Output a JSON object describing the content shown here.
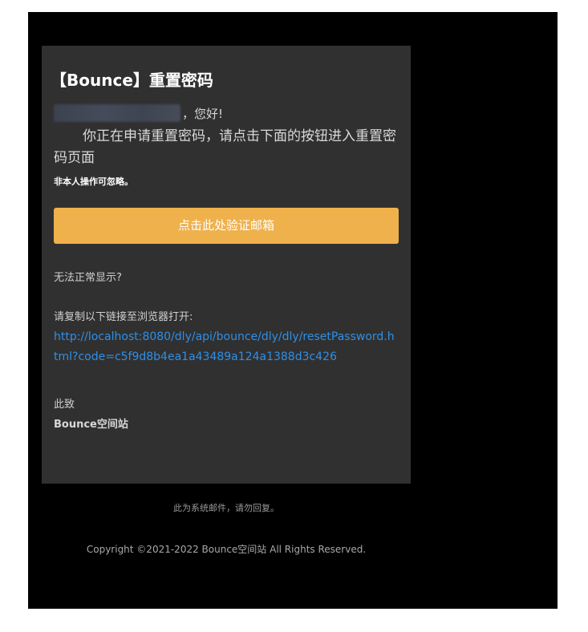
{
  "email": {
    "title": "【Bounce】重置密码",
    "greeting_suffix": "，您好!",
    "main_text": "你正在申请重置密码，请点击下面的按钮进入重置密码页面",
    "ignore_note": "非本人操作可忽略。",
    "button_label": "点击此处验证邮箱",
    "cant_display": "无法正常显示?",
    "copy_prompt": "请复制以下链接至浏览器打开:",
    "reset_link": "http://localhost:8080/dly/api/bounce/dly/dly/resetPassword.html?code=c5f9d8b4ea1a43489a124a1388d3c426",
    "sign_off": "此致",
    "sign_name": "Bounce空间站",
    "footer_note": "此为系统邮件，请勿回复。",
    "copyright": "Copyright ©2021-2022 Bounce空间站 All Rights Reserved."
  },
  "colors": {
    "page_background": "#000000",
    "card_background": "#303030",
    "button_background": "#efb14c",
    "link_color": "#2f8fe6"
  }
}
